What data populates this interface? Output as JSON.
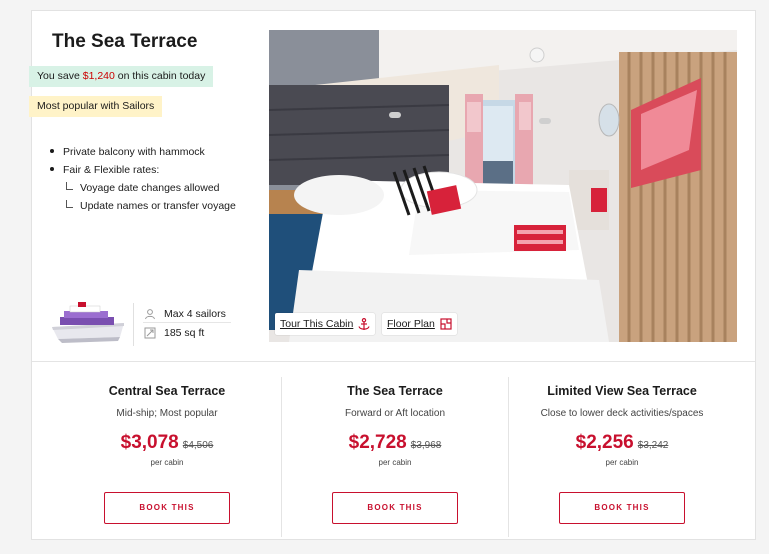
{
  "cabin": {
    "title": "The Sea Terrace",
    "save_prefix": "You save ",
    "save_amount": "$1,240",
    "save_suffix": " on this cabin today",
    "popular_label": "Most popular with Sailors",
    "features": [
      "Private balcony with hammock",
      "Fair & Flexible rates:"
    ],
    "sub_features": [
      "Voyage date changes allowed",
      "Update names or transfer voyage"
    ],
    "max_sailors": "Max 4 sailors",
    "size": "185 sq ft",
    "tour_label": "Tour This Cabin",
    "floor_plan_label": "Floor Plan"
  },
  "options": [
    {
      "name": "Central Sea Terrace",
      "desc": "Mid-ship; Most popular",
      "price": "$3,078",
      "orig": "$4,506",
      "per": "per cabin",
      "button": "BOOK THIS"
    },
    {
      "name": "The Sea Terrace",
      "desc": "Forward or Aft location",
      "price": "$2,728",
      "orig": "$3,968",
      "per": "per cabin",
      "button": "BOOK THIS"
    },
    {
      "name": "Limited View Sea Terrace",
      "desc": "Close to lower deck activities/spaces",
      "price": "$2,256",
      "orig": "$3,242",
      "per": "per cabin",
      "button": "BOOK THIS"
    }
  ],
  "colors": {
    "accent": "#c8102e",
    "save_badge_bg": "#d8f2e6",
    "popular_badge_bg": "#fff3c8"
  },
  "icons": [
    "user-icon",
    "area-icon",
    "anchor-icon",
    "floor-plan-icon",
    "ship-icon"
  ]
}
